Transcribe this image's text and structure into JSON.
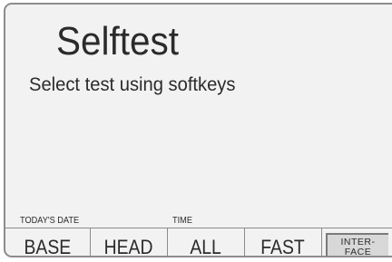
{
  "screen": {
    "title": "Selftest",
    "subtitle": "Select test using softkeys"
  },
  "status_bar": {
    "date_label": "TODAY'S DATE",
    "time_label": "TIME"
  },
  "softkeys": [
    {
      "label": "BASE"
    },
    {
      "label": "HEAD"
    },
    {
      "label": "ALL"
    },
    {
      "label": "FAST"
    },
    {
      "label_line1": "INTER-",
      "label_line2": "FACE"
    }
  ]
}
